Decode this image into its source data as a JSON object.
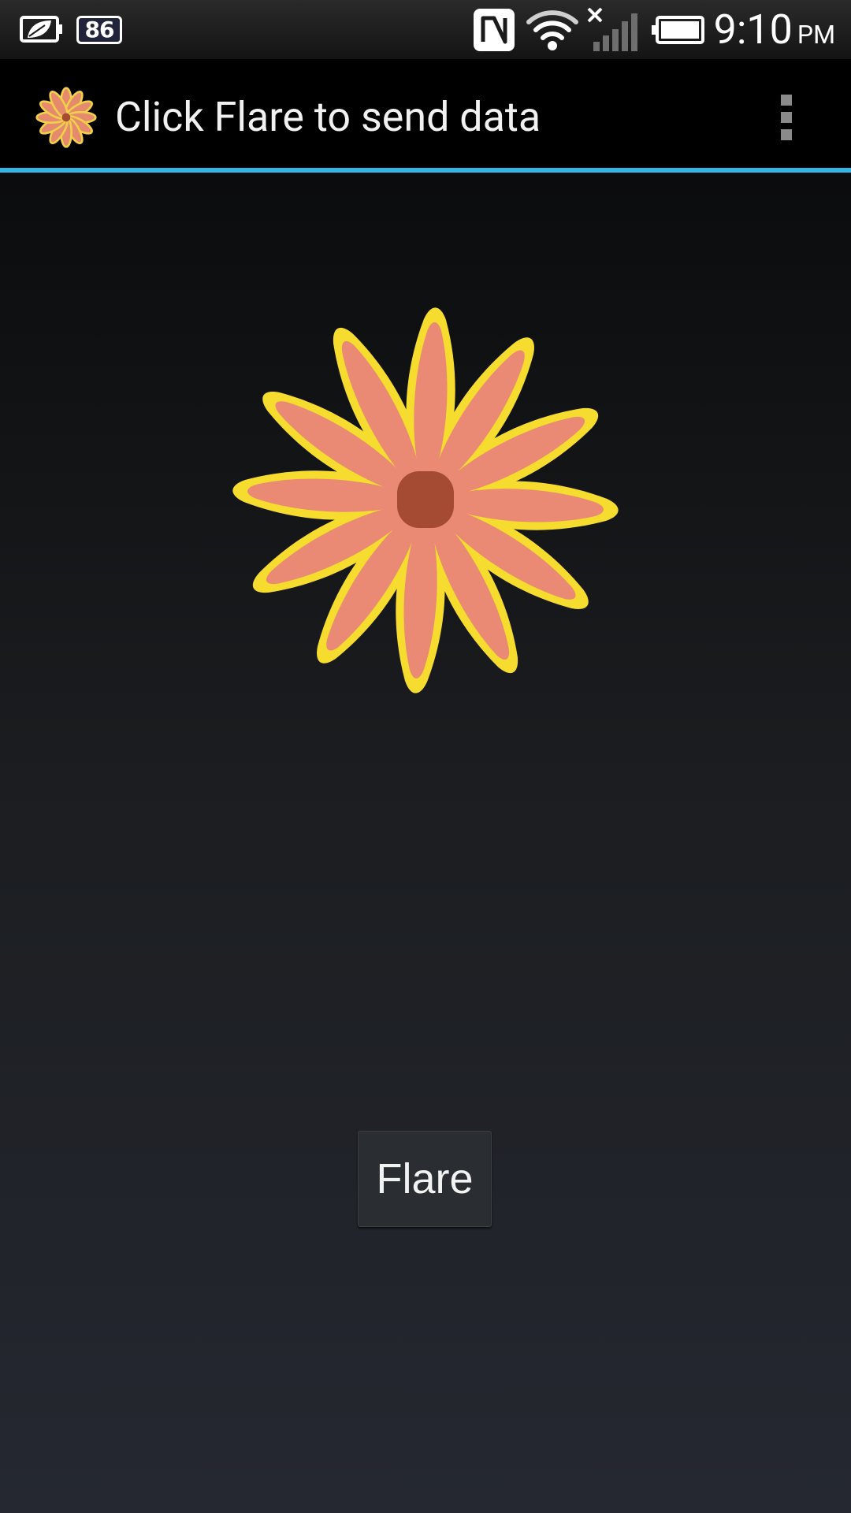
{
  "status_bar": {
    "battery_level": "86",
    "time": "9:10",
    "ampm": "PM",
    "icons": [
      "battery-saver-icon",
      "battery-level-icon",
      "nfc-icon",
      "wifi-icon",
      "signal-icon",
      "battery-icon"
    ]
  },
  "action_bar": {
    "title": "Click Flare to send data",
    "app_icon": "flower-icon",
    "overflow_icon": "overflow-menu-icon",
    "divider_color": "#33b5e5"
  },
  "main": {
    "image": "flower-image",
    "button_label": "Flare"
  },
  "colors": {
    "petal": "#ea8a74",
    "petal_outline": "#f5dc2e",
    "center": "#a54a33"
  }
}
